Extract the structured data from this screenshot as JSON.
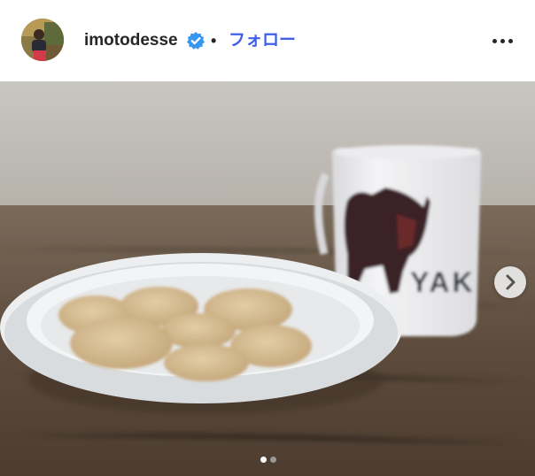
{
  "post": {
    "username": "imotodesse",
    "verified": true,
    "separator": "•",
    "follow_label": "フォロー"
  },
  "photo": {
    "mug_text": "YAK",
    "carousel_index": 1,
    "carousel_total": 2
  },
  "icons": {
    "verified": "verified-badge-icon",
    "more": "more-options-icon",
    "next": "chevron-right-icon"
  },
  "colors": {
    "follow_link": "#3f5fe8",
    "verified_badge": "#3897f0",
    "text": "#262626"
  }
}
